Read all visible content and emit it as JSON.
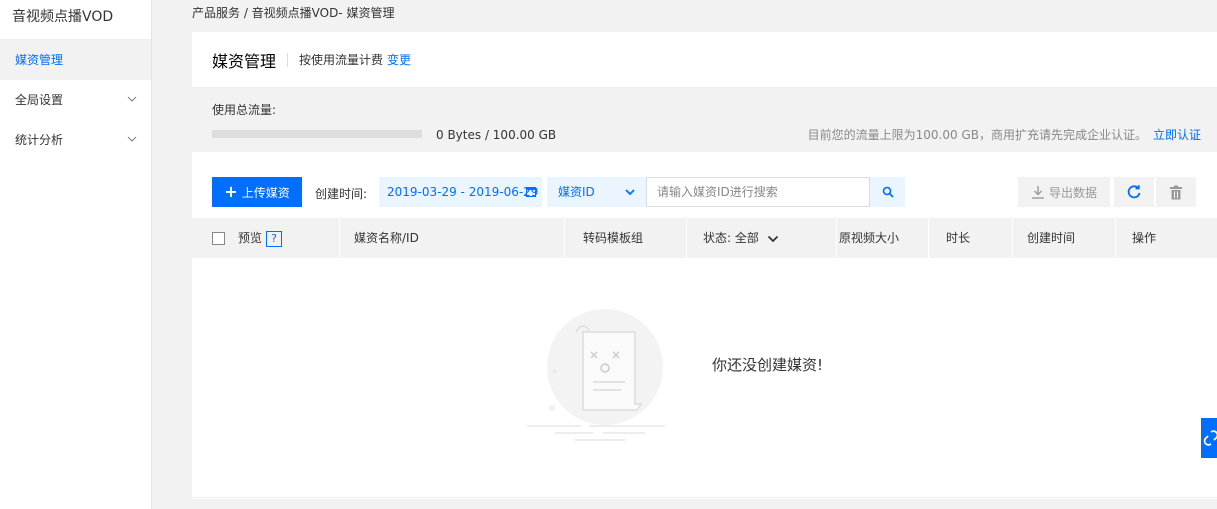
{
  "sidebar": {
    "title": "音视频点播VOD",
    "items": [
      {
        "label": "媒资管理"
      },
      {
        "label": "全局设置"
      },
      {
        "label": "统计分析"
      }
    ]
  },
  "breadcrumb": "产品服务 / 音视频点播VOD- 媒资管理",
  "header": {
    "title": "媒资管理",
    "billing_note": "按使用流量计费",
    "billing_link": "变更"
  },
  "usage": {
    "label": "使用总流量:",
    "value": "0 Bytes / 100.00 GB",
    "progress_percent": 0,
    "tip": "目前您的流量上限为100.00 GB，商用扩充请先完成企业认证。",
    "tip_link": "立即认证"
  },
  "toolbar": {
    "upload_label": "上传媒资",
    "date_label": "创建时间:",
    "date_range": "2019-03-29 - 2019-06-29",
    "field_select": "媒资ID",
    "search_placeholder": "请输入媒资ID进行搜索",
    "export_label": "导出数据"
  },
  "table": {
    "columns": {
      "preview": "预览",
      "help": "?",
      "name": "媒资名称/ID",
      "template": "转码模板组",
      "status": "状态: 全部",
      "size": "原视频大小",
      "duration": "时长",
      "created": "创建时间",
      "actions": "操作"
    },
    "empty_text": "你还没创建媒资!"
  },
  "colors": {
    "accent": "#006eff",
    "accent_bg": "#ebf5ff",
    "panel_bg": "#f2f2f2"
  },
  "icons": [
    "chevron-down-icon",
    "calendar-icon",
    "search-icon",
    "download-icon",
    "refresh-icon",
    "trash-icon",
    "link-icon"
  ]
}
